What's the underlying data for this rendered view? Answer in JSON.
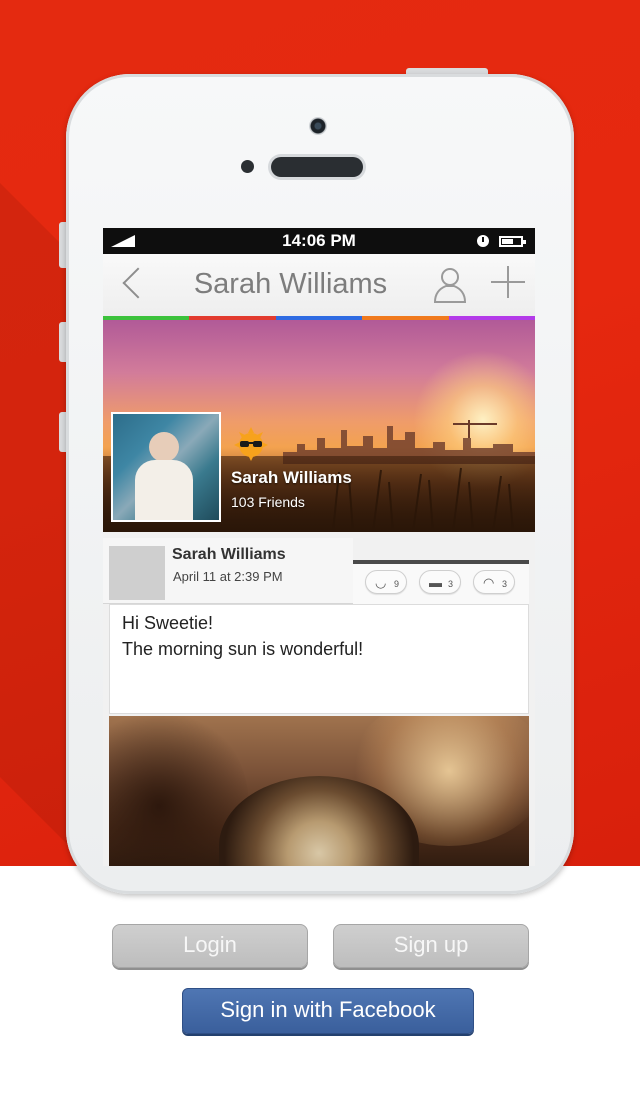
{
  "colors": {
    "background_red": "#e42a10",
    "facebook_blue": "#3b5998",
    "button_gray": "#c4c4c4"
  },
  "phone": {
    "status_bar": {
      "time": "14:06 PM",
      "icons": [
        "signal-icon",
        "clock-icon",
        "battery-icon"
      ]
    },
    "nav_bar": {
      "title": "Sarah Williams",
      "icons": [
        "back-chevron-icon",
        "profile-icon",
        "add-icon"
      ]
    },
    "color_strip": [
      "#3cc23c",
      "#e23b2f",
      "#2f6be2",
      "#f07a1e",
      "#b33be8"
    ],
    "profile": {
      "name": "Sarah Williams",
      "friends": "103 Friends",
      "mood_icon": "sunglasses-sun-icon"
    },
    "post": {
      "author": "Sarah Williams",
      "date": "April 11 at 2:39 PM",
      "line1": "Hi Sweetie!",
      "line2": "The morning sun is wonderful!",
      "reactions": [
        {
          "icon": "smile-icon",
          "count": "9"
        },
        {
          "icon": "comment-icon",
          "count": "3"
        },
        {
          "icon": "sad-icon",
          "count": "3"
        }
      ]
    }
  },
  "actions": {
    "login_label": "Login",
    "signup_label": "Sign up",
    "facebook_label": "Sign in with Facebook"
  }
}
